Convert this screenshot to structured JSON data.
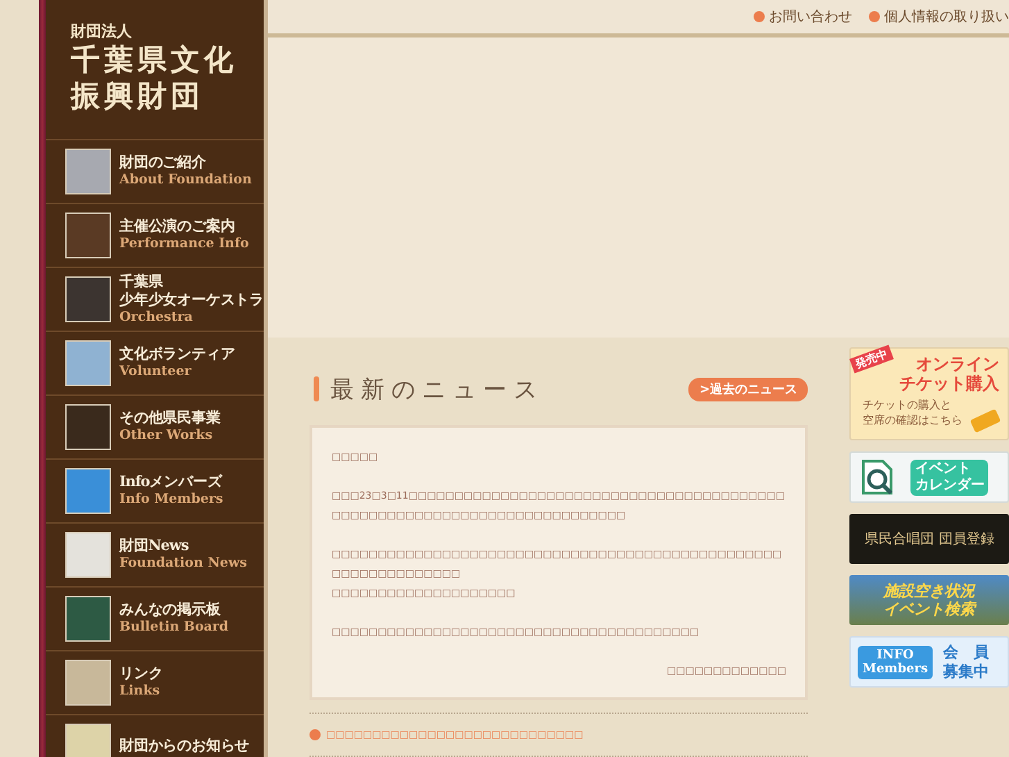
{
  "logo": {
    "kicker": "財団法人",
    "name_line_1": "千葉県文化",
    "name_line_2": "振興財団"
  },
  "sidebar": {
    "items": [
      {
        "title": "財団のご紹介",
        "subtitle": "About Foundation"
      },
      {
        "title": "主催公演のご案内",
        "subtitle": "Performance Info"
      },
      {
        "title": [
          "千葉県",
          "少年少女オーケストラ"
        ],
        "subtitle": "Orchestra"
      },
      {
        "title": "文化ボランティア",
        "subtitle": "Volunteer"
      },
      {
        "title": "その他県民事業",
        "subtitle": "Other Works"
      },
      {
        "title": "Infoメンバーズ",
        "subtitle": "Info Members"
      },
      {
        "title": "財団News",
        "subtitle": "Foundation News"
      },
      {
        "title": "みんなの掲示板",
        "subtitle": "Bulletin Board"
      },
      {
        "title": "リンク",
        "subtitle": "Links"
      },
      {
        "title": "財団からのお知らせ"
      }
    ]
  },
  "top_links": [
    "お問い合わせ",
    "個人情報の取り扱い"
  ],
  "news": {
    "heading": "最新のニュース",
    "past_button": ">過去のニュース",
    "paragraphs": [
      [
        "□□□□□"
      ],
      [
        "□□□23□3□11□□□□□□□□□□□□□□□□□□□□□□□□□□□□□□□□□□□□□□□□□□□□□□□□□□□□□□□□□□□□□□□□□□□□□□□□□"
      ],
      [
        "□□□□□□□□□□□□□□□□□□□□□□□□□□□□□□□□□□□□□□□□□□□□□□□□□□□□□□□□□□□□□□□",
        "□□□□□□□□□□□□□□□□□□□□"
      ],
      [
        "□□□□□□□□□□□□□□□□□□□□□□□□□□□□□□□□□□□□□□□□"
      ]
    ],
    "signature": "□□□□□□□□□□□□□",
    "links": [
      "□□□□□□□□□□□□□□□□□□□□□□□□□□□□"
    ]
  },
  "banners": [
    {
      "kind": "ticket",
      "badge": "発売中",
      "title": [
        "オンライン",
        "チケット購入"
      ],
      "text": [
        "チケットの購入と",
        "空席の確認はこちら"
      ]
    },
    {
      "kind": "calendar",
      "title": [
        "イベント",
        "カレンダー"
      ]
    },
    {
      "kind": "choir",
      "title": [
        "県民合唱団 団員登録"
      ]
    },
    {
      "kind": "facility",
      "title": [
        "施設空き状況",
        "イベント検索"
      ]
    },
    {
      "kind": "members",
      "logo": [
        "INFO",
        "Members"
      ],
      "title": [
        "会　員",
        "募集中"
      ]
    }
  ]
}
